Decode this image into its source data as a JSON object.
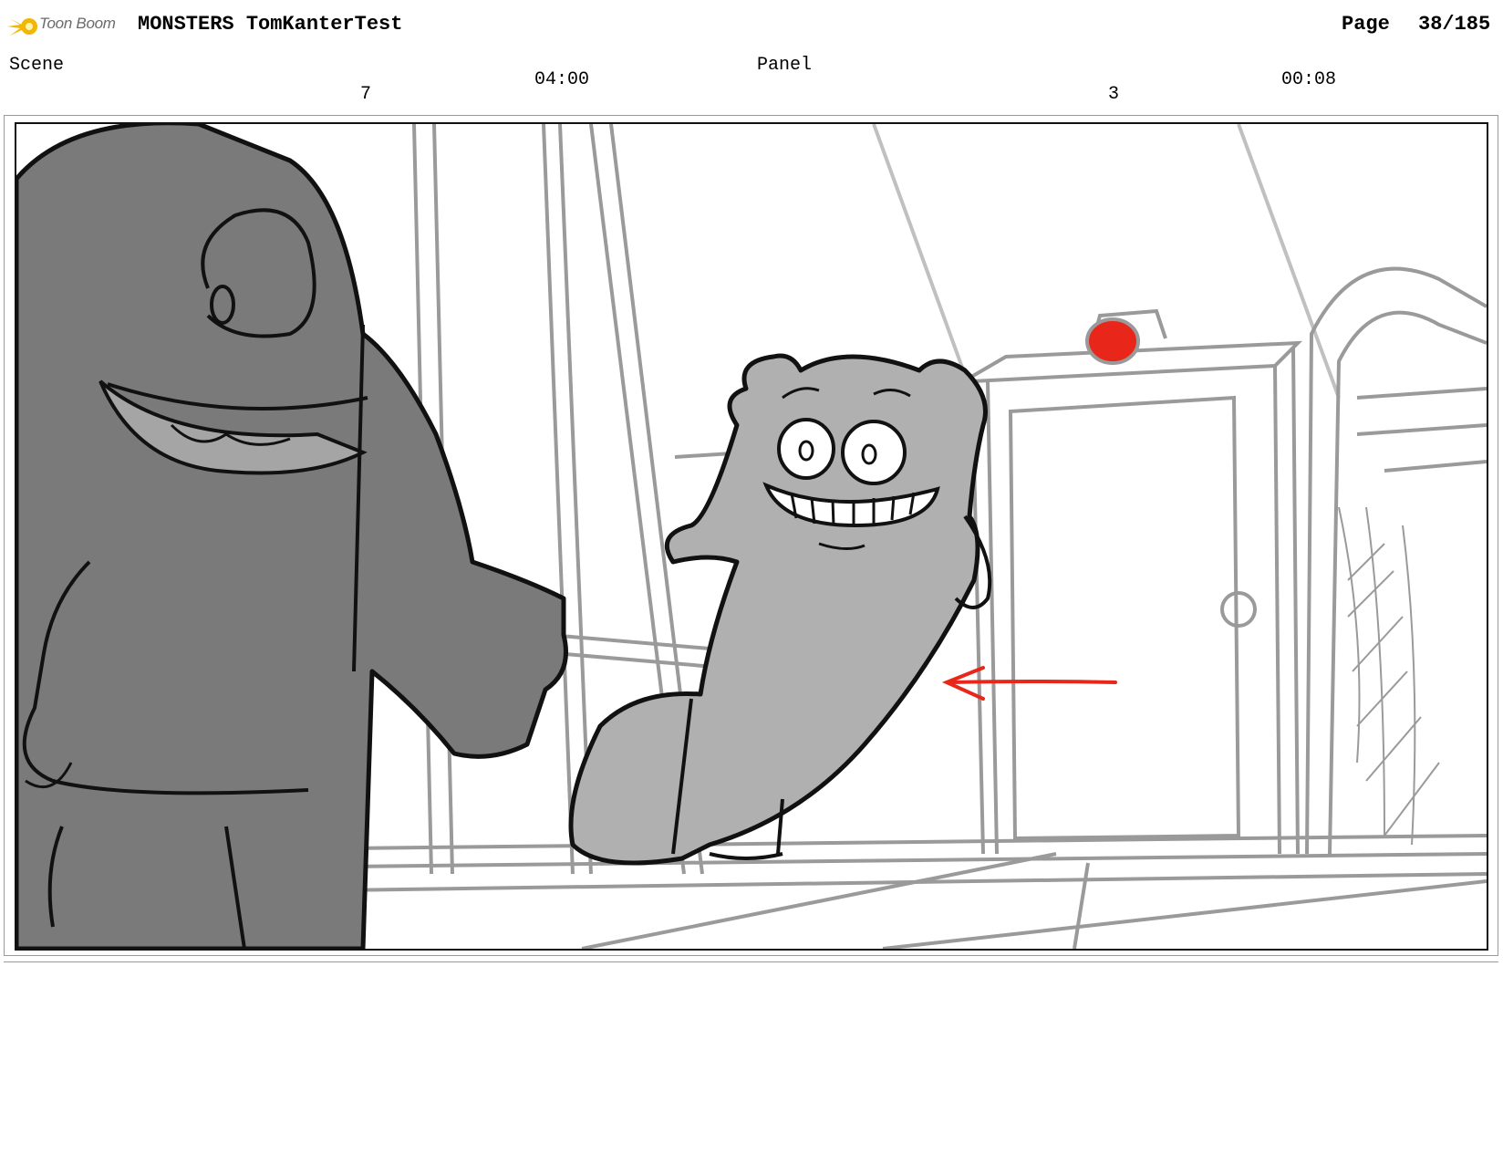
{
  "header": {
    "logo_icon": "toon-boom-sparkle-icon",
    "logo_text": "Toon Boom",
    "title": "MONSTERS TomKanterTest",
    "page_label": "Page",
    "page_value": "38/185"
  },
  "scene": {
    "label": "Scene",
    "number": "7",
    "duration": "04:00"
  },
  "panel": {
    "label": "Panel",
    "number": "3",
    "duration": "00:08"
  },
  "colors": {
    "logo_yellow": "#f2b705",
    "big_monster_fill": "#7a7a7a",
    "small_monster_fill": "#b0b0b0",
    "door_light": "#e8261a",
    "motion_arrow": "#e8261a",
    "background_lines": "#9a9a9a"
  }
}
